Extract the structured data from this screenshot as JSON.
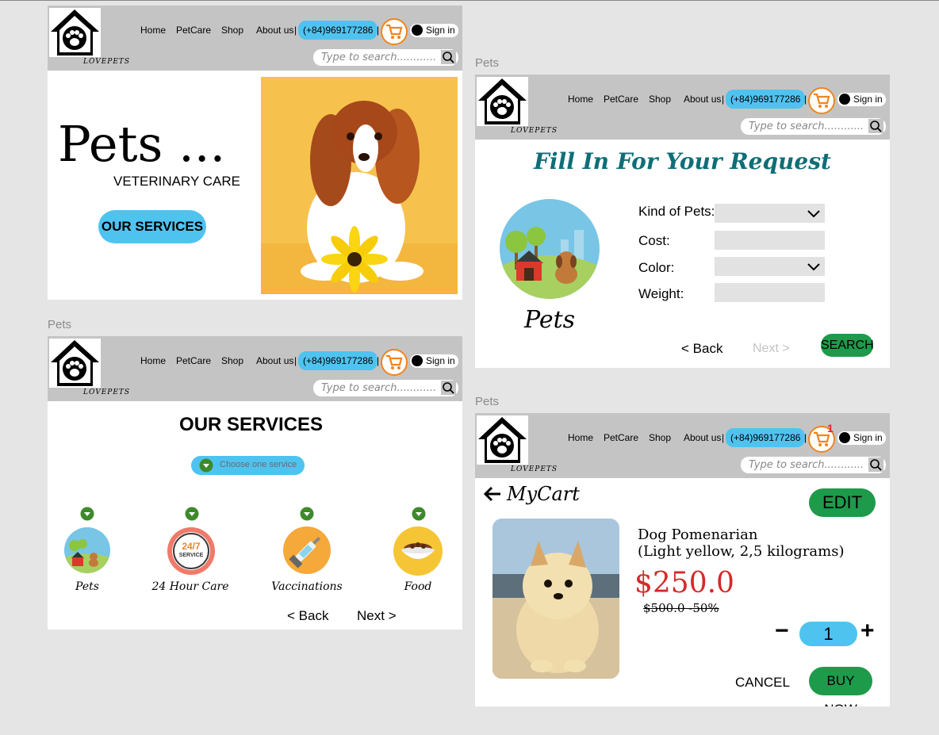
{
  "labels": {
    "frame_b": "Pets",
    "frame_c": "Pets",
    "frame_d": "Pets"
  },
  "header": {
    "brand": "LOVEPETS",
    "nav": {
      "home": "Home",
      "petcare": "PetCare",
      "shop": "Shop",
      "about": "About us"
    },
    "separator": "|",
    "phone": "(+84)969177286",
    "signin": "Sign in",
    "search_placeholder": "Type to search............",
    "cart_badge": "1",
    "icons": {
      "logo": "paw-house-logo-icon",
      "cart": "shopping-cart-icon",
      "user": "user-icon",
      "search": "search-icon"
    }
  },
  "home": {
    "title": "Pets ...",
    "subtitle": "VETERINARY CARE",
    "cta": "OUR SERVICES",
    "hero_image": "puppy-with-sunflower-image"
  },
  "request": {
    "title": "Fill In For Your Request",
    "image_caption": "Pets",
    "fields": {
      "kind": "Kind of Pets:",
      "cost": "Cost:",
      "color": "Color:",
      "weight": "Weight:"
    },
    "back": "< Back",
    "next": "Next >",
    "search": "SEARCH"
  },
  "services": {
    "title": "OUR SERVICES",
    "chooser": "Choose one service",
    "items": [
      {
        "label": "Pets",
        "icon": "pets-icon"
      },
      {
        "label": "24 Hour Care",
        "icon": "24-7-service-icon"
      },
      {
        "label": "Vaccinations",
        "icon": "syringe-icon"
      },
      {
        "label": "Food",
        "icon": "food-bowl-icon"
      }
    ],
    "badge_247": "24/7",
    "badge_service": "SERVICE",
    "back": "< Back",
    "next": "Next >"
  },
  "cart": {
    "title": "MyCart",
    "edit": "EDIT",
    "product_name": "Dog Pomenarian",
    "product_detail": "(Light yellow, 2,5 kilograms)",
    "price": "$250.0",
    "old_price": "$500.0 -50%",
    "minus": "−",
    "quantity": "1",
    "plus": "+",
    "cancel": "CANCEL",
    "buy": "BUY NOW"
  },
  "colors": {
    "accent_blue": "#4fc3f0",
    "green": "#1e9a4b",
    "price_red": "#d42a2a",
    "header_gray": "#c4c4c4",
    "cart_orange": "#f0851d"
  }
}
